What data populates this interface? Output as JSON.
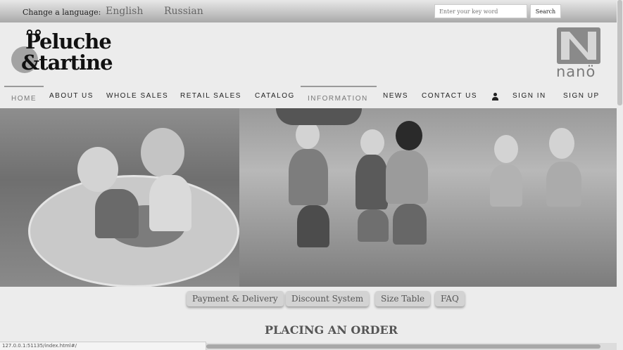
{
  "topbar": {
    "change_language_label": "Change a language:",
    "languages": [
      "English",
      "Russian"
    ],
    "search_placeholder": "Enter your key word",
    "search_button": "Search"
  },
  "brand": {
    "logo_line1": "Peluche",
    "logo_line2": "&tartine",
    "partner_logo": "nanö"
  },
  "nav": {
    "items": [
      "HOME",
      "ABOUT US",
      "WHOLE SALES",
      "RETAIL SALES",
      "CATALOG",
      "INFORMATION",
      "NEWS",
      "CONTACT US",
      "SIGN IN",
      "SIGN UP"
    ],
    "user_icon": "user-icon"
  },
  "sub_nav": [
    "Payment & Delivery",
    "Discount System",
    "Size Table",
    "FAQ"
  ],
  "main": {
    "heading": "PLACING AN ORDER"
  },
  "status_bar": {
    "url": "127.0.0.1:51135/index.html#/"
  }
}
